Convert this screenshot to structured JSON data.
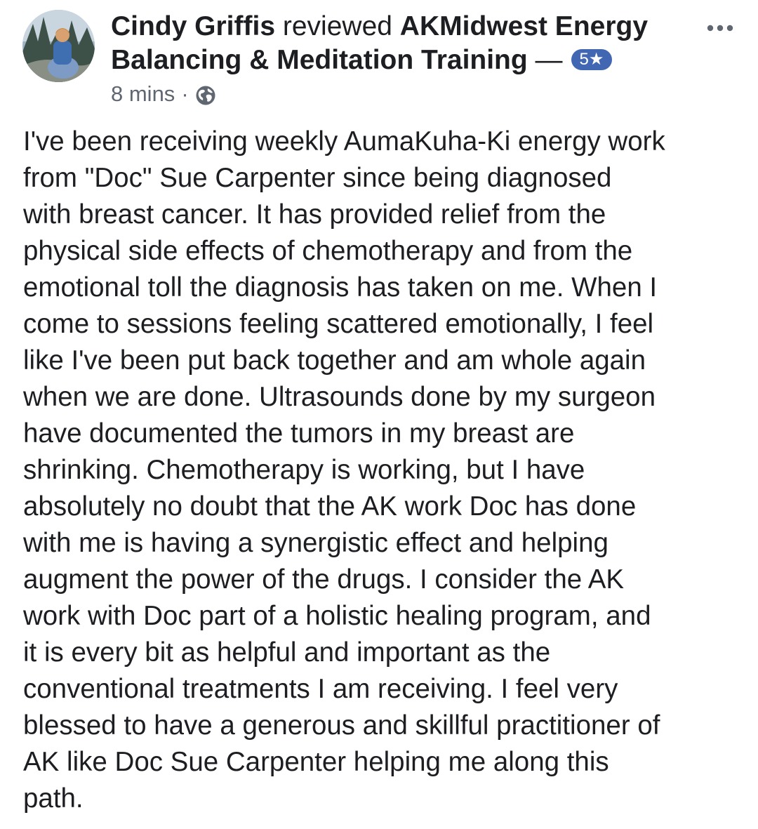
{
  "reviewer": {
    "name": "Cindy Griffis",
    "avatar_icon": "profile-photo"
  },
  "header": {
    "verb": "reviewed",
    "page_name": "AKMidwest Energy Balancing & Meditation Training",
    "dash": "—",
    "rating": "5★"
  },
  "meta": {
    "time": "8 mins",
    "separator": "·",
    "audience_icon": "globe-icon"
  },
  "more_icon": "more-options-icon",
  "review": {
    "lines": [
      "I've been receiving weekly AumaKuha-Ki energy work",
      "from \"Doc\" Sue Carpenter since being diagnosed",
      "with breast cancer. It has provided relief from the",
      "physical side effects of chemotherapy and from the",
      "emotional toll the diagnosis has taken on me. When I",
      "come to sessions feeling scattered emotionally, I feel",
      "like I've been put back together and am whole again",
      "when we are done. Ultrasounds done by my surgeon",
      "have documented the tumors in my breast are",
      "shrinking. Chemotherapy is working, but I have",
      "absolutely no doubt that the AK work Doc has done",
      "with me is having a synergistic effect and helping",
      "augment the power of the drugs. I consider the AK",
      "work with Doc part of a holistic healing program, and",
      "it is every bit as helpful and important as the",
      "conventional treatments I am receiving. I feel very",
      "blessed to have a generous and skillful practitioner of",
      "AK like Doc Sue Carpenter helping me along this",
      "path."
    ]
  },
  "colors": {
    "text": "#1c1e21",
    "secondary": "#606770",
    "badge": "#4267b2"
  }
}
